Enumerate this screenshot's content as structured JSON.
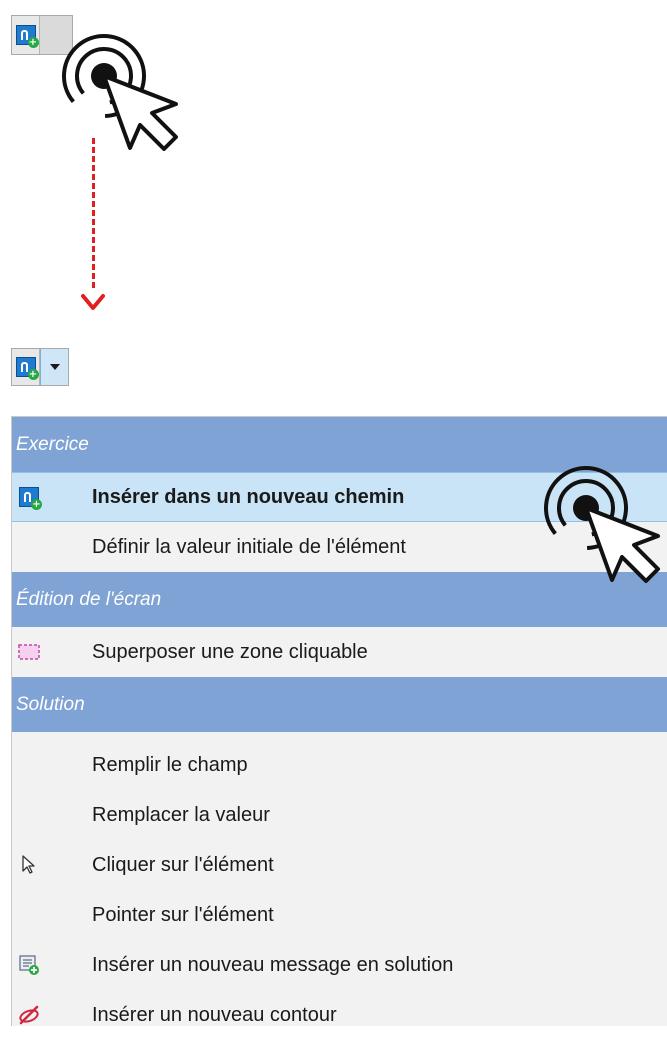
{
  "menu": {
    "groups": [
      {
        "label": "Exercice",
        "items": [
          {
            "label": "Insérer dans un nouveau chemin",
            "icon": "app-icon",
            "active": true
          },
          {
            "label": "Définir la valeur initiale de l'élément",
            "icon": ""
          }
        ]
      },
      {
        "label": "Édition de l'écran",
        "items": [
          {
            "label": "Superposer une zone cliquable",
            "icon": "dashed-rect-icon"
          }
        ]
      },
      {
        "label": "Solution",
        "items": [
          {
            "label": "Remplir le champ",
            "icon": ""
          },
          {
            "label": "Remplacer la valeur",
            "icon": ""
          },
          {
            "label": "Cliquer sur l'élément",
            "icon": "cursor-icon"
          },
          {
            "label": "Pointer sur l'élément",
            "icon": ""
          },
          {
            "label": "Insérer un nouveau message en solution",
            "icon": "message-icon"
          },
          {
            "label": "Insérer un nouveau contour",
            "icon": "contour-icon"
          }
        ]
      }
    ]
  },
  "colors": {
    "group_header": "#7fa3d4",
    "active_item": "#c9e4f6",
    "connector": "#e02020"
  }
}
